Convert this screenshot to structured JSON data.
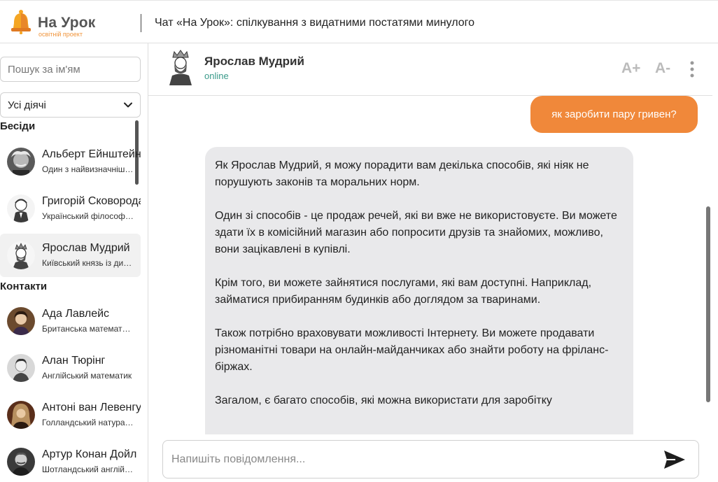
{
  "header": {
    "logo_title": "На Урок",
    "logo_subtitle": "освітній проект",
    "title": "Чат «На Урок»: спілкування з видатними постатями минулого"
  },
  "sidebar": {
    "search_placeholder": "Пошук за ім'ям",
    "filter_value": "Усі діячі",
    "conversations_title": "Бесіди",
    "conversations": [
      {
        "name": "Альберт Ейнштейн",
        "desc": "Один з найвизначніших фізиків",
        "icon": "einstein-avatar"
      },
      {
        "name": "Григорій Сковорода",
        "desc": "Український філософ і поет",
        "icon": "skovoroda-avatar"
      },
      {
        "name": "Ярослав Мудрий",
        "desc": "Київський князь із династії Рюриковичів",
        "icon": "yaroslav-avatar"
      }
    ],
    "contacts_title": "Контакти",
    "contacts": [
      {
        "name": "Ада Лавлейс",
        "desc": "Британська математикиня",
        "icon": "lovelace-avatar"
      },
      {
        "name": "Алан Тюрінг",
        "desc": "Англійський математик",
        "icon": "turing-avatar"
      },
      {
        "name": "Антоні ван Левенгук",
        "desc": "Голландський натураліст",
        "icon": "leeuwenhoek-avatar"
      },
      {
        "name": "Артур Конан Дойл",
        "desc": "Шотландський англійський письменник",
        "icon": "doyle-avatar"
      }
    ]
  },
  "chat": {
    "name": "Ярослав Мудрий",
    "status": "online",
    "font_increase": "A+",
    "font_decrease": "A-",
    "user_message": "як заробити пару гривен?",
    "bot_message": [
      "Як Ярослав Мудрий, я можу порадити вам декілька способів, які ніяк не порушують законів та моральних норм.",
      "Один зі способів - це продаж речей, які ви вже не використовуєте. Ви можете здати їх в комісійний магазин або попросити друзів та знайомих, можливо, вони зацікавлені в купівлі.",
      "Крім того, ви можете зайнятися послугами, які вам доступні. Наприклад, займатися прибиранням будинків або доглядом за тваринами.",
      "Також потрібно враховувати можливості Інтернету. Ви можете продавати різноманітні товари на онлайн-майданчиках або знайти роботу на фріланс-біржах.",
      "Загалом, є багато способів, які можна використати для заробітку"
    ],
    "composer_placeholder": "Напишіть повідомлення..."
  },
  "colors": {
    "accent": "#f0883a",
    "status": "#3a9a8a",
    "bot_bubble": "#e9e9eb"
  }
}
